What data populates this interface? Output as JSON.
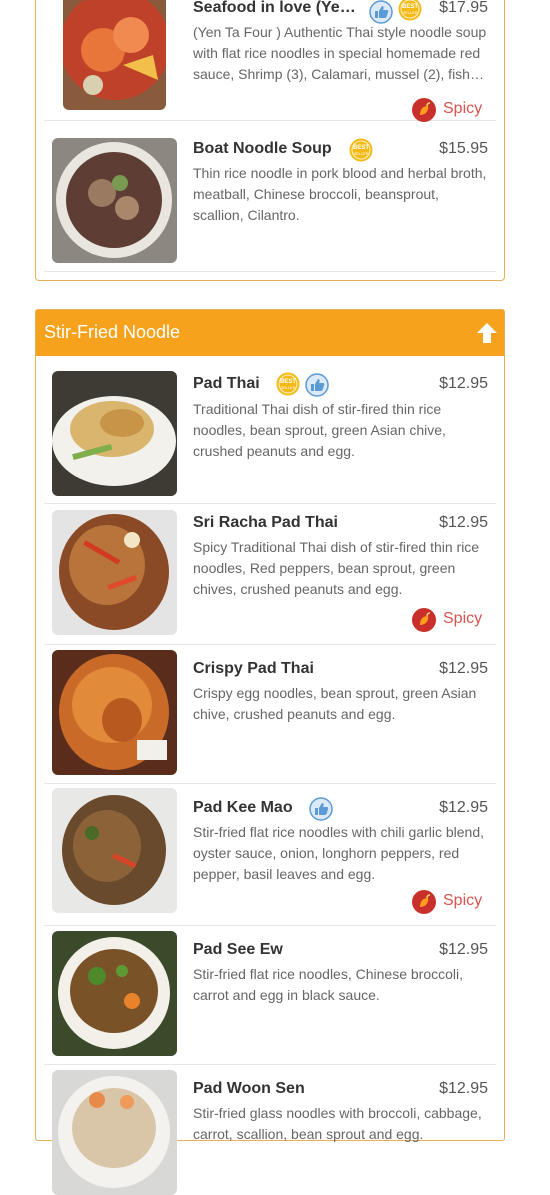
{
  "badges": {
    "best_seller": "BEST SELLER"
  },
  "spicy_label": "Spicy",
  "section_noodle_soup": {
    "items": [
      {
        "name": "Seafood in love (Ye…",
        "price": "$17.95",
        "desc": "(Yen Ta Four ) Authentic Thai style noodle soup with flat rice noodles in special homemade red sauce, Shrimp (3), Calamari, mussel (2), fish…"
      },
      {
        "name": "Boat Noodle Soup",
        "price": "$15.95",
        "desc": "Thin rice noodle in pork blood and herbal broth, meatball, Chinese broccoli, beansprout, scallion, Cilantro."
      }
    ]
  },
  "section_stir_fried": {
    "title": "Stir-Fried Noodle",
    "items": [
      {
        "name": "Pad Thai",
        "price": "$12.95",
        "desc": "Traditional Thai dish of stir-fired thin rice noodles, bean sprout, green Asian chive, crushed peanuts and egg."
      },
      {
        "name": "Sri Racha Pad Thai",
        "price": "$12.95",
        "desc": "Spicy Traditional Thai dish of stir-fired thin rice noodles, Red peppers, bean sprout, green chives, crushed peanuts and egg."
      },
      {
        "name": "Crispy Pad Thai",
        "price": "$12.95",
        "desc": "Crispy egg noodles, bean sprout, green Asian chive, crushed peanuts and egg."
      },
      {
        "name": "Pad Kee Mao",
        "price": "$12.95",
        "desc": "Stir-fried flat rice noodles with chili garlic blend, oyster sauce, onion, longhorn peppers, red pepper, basil leaves and egg."
      },
      {
        "name": "Pad See Ew",
        "price": "$12.95",
        "desc": "Stir-fried flat rice noodles, Chinese broccoli, carrot and egg in black sauce."
      },
      {
        "name": "Pad Woon Sen",
        "price": "$12.95",
        "desc": "Stir-fried glass noodles with broccoli, cabbage, carrot, scallion, bean sprout and egg."
      }
    ]
  },
  "colors": {
    "accent": "#f6a21c",
    "spicy": "#d9534f",
    "like_badge": "#5b9bd5",
    "best_badge": "#f5b916"
  },
  "icons": {
    "like": "thumbs-up-icon",
    "best": "best-seller-icon",
    "spicy": "chili-icon",
    "top": "arrow-up-icon"
  }
}
